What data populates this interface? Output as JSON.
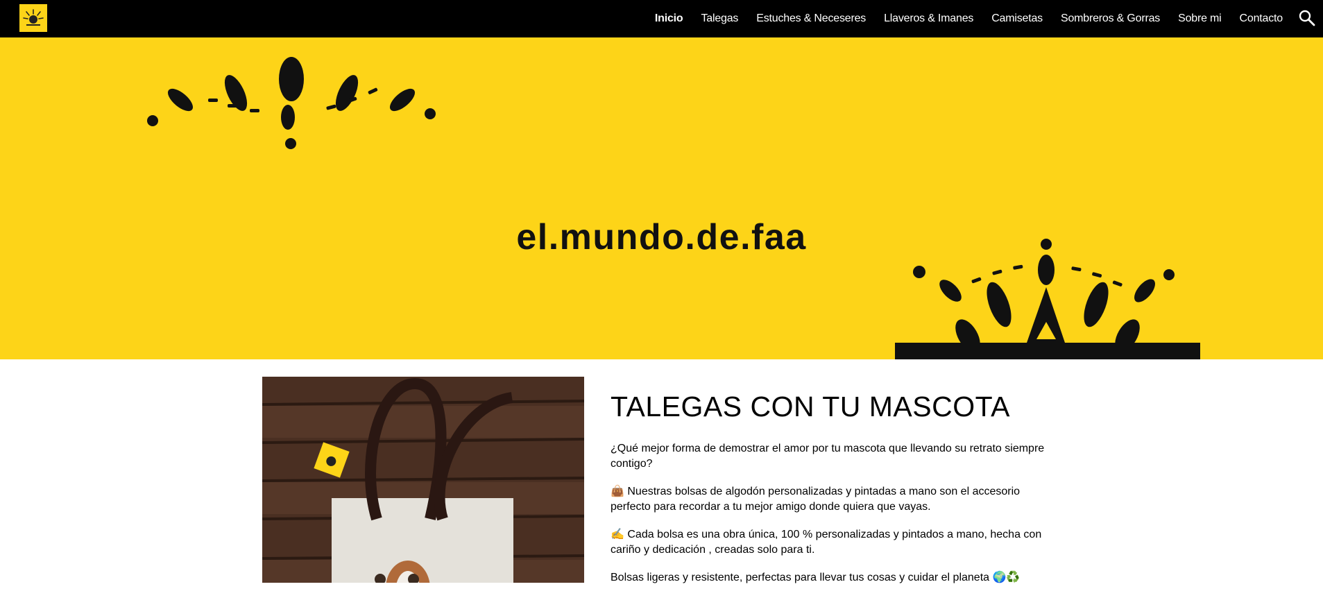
{
  "header": {
    "logo_icon": "sun-logo-icon",
    "nav": [
      {
        "label": "Inicio",
        "active": true
      },
      {
        "label": "Talegas"
      },
      {
        "label": "Estuches & Neceseres"
      },
      {
        "label": "Llaveros & Imanes"
      },
      {
        "label": "Camisetas"
      },
      {
        "label": "Sombreros & Gorras"
      },
      {
        "label": "Sobre mi"
      },
      {
        "label": "Contacto"
      }
    ],
    "search_icon": "search-icon"
  },
  "hero": {
    "title": "el.mundo.de.faa",
    "background": "#FDD418"
  },
  "main": {
    "heading": "TALEGAS CON TU MASCOTA",
    "paragraphs": [
      "¿Qué mejor forma de demostrar el amor por tu mascota que llevando su retrato siempre contigo?",
      "👜 Nuestras bolsas de algodón personalizadas y pintadas a mano son el accesorio perfecto para recordar a tu mejor amigo donde quiera que vayas.",
      "✍️ Cada bolsa es una obra única, 100 % personalizadas y pintados a mano, hecha con cariño y dedicación , creadas solo para ti.",
      "Bolsas ligeras y resistente, perfectas para llevar tus cosas y cuidar el planeta 🌍♻️"
    ],
    "image_icon": "tote-bag-photo"
  }
}
